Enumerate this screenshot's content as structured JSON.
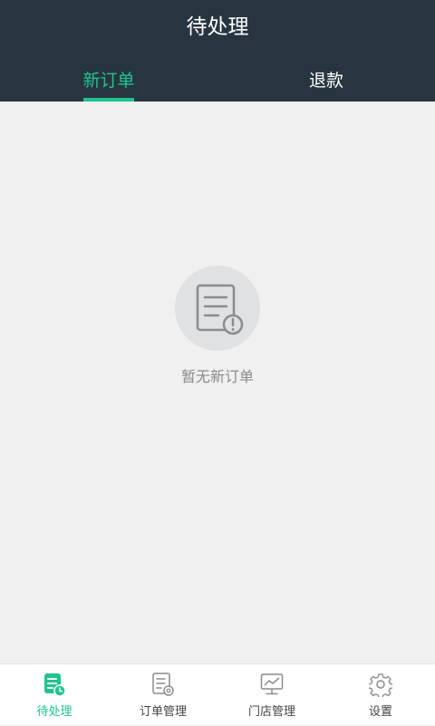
{
  "header": {
    "title": "待处理",
    "tabs": [
      {
        "label": "新订单",
        "active": true
      },
      {
        "label": "退款",
        "active": false
      }
    ]
  },
  "empty_state": {
    "icon": "document-alert-icon",
    "message": "暂无新订单"
  },
  "bottom_nav": {
    "items": [
      {
        "label": "待处理",
        "icon": "pending-orders-icon",
        "active": true
      },
      {
        "label": "订单管理",
        "icon": "order-manage-icon",
        "active": false
      },
      {
        "label": "门店管理",
        "icon": "store-manage-icon",
        "active": false
      },
      {
        "label": "设置",
        "icon": "gear-icon",
        "active": false
      }
    ]
  },
  "colors": {
    "header_bg": "#273540",
    "accent": "#1fc48d",
    "page_bg": "#f0f0f0",
    "muted_text": "#8a8a8a",
    "icon_gray": "#8c8c8c"
  }
}
